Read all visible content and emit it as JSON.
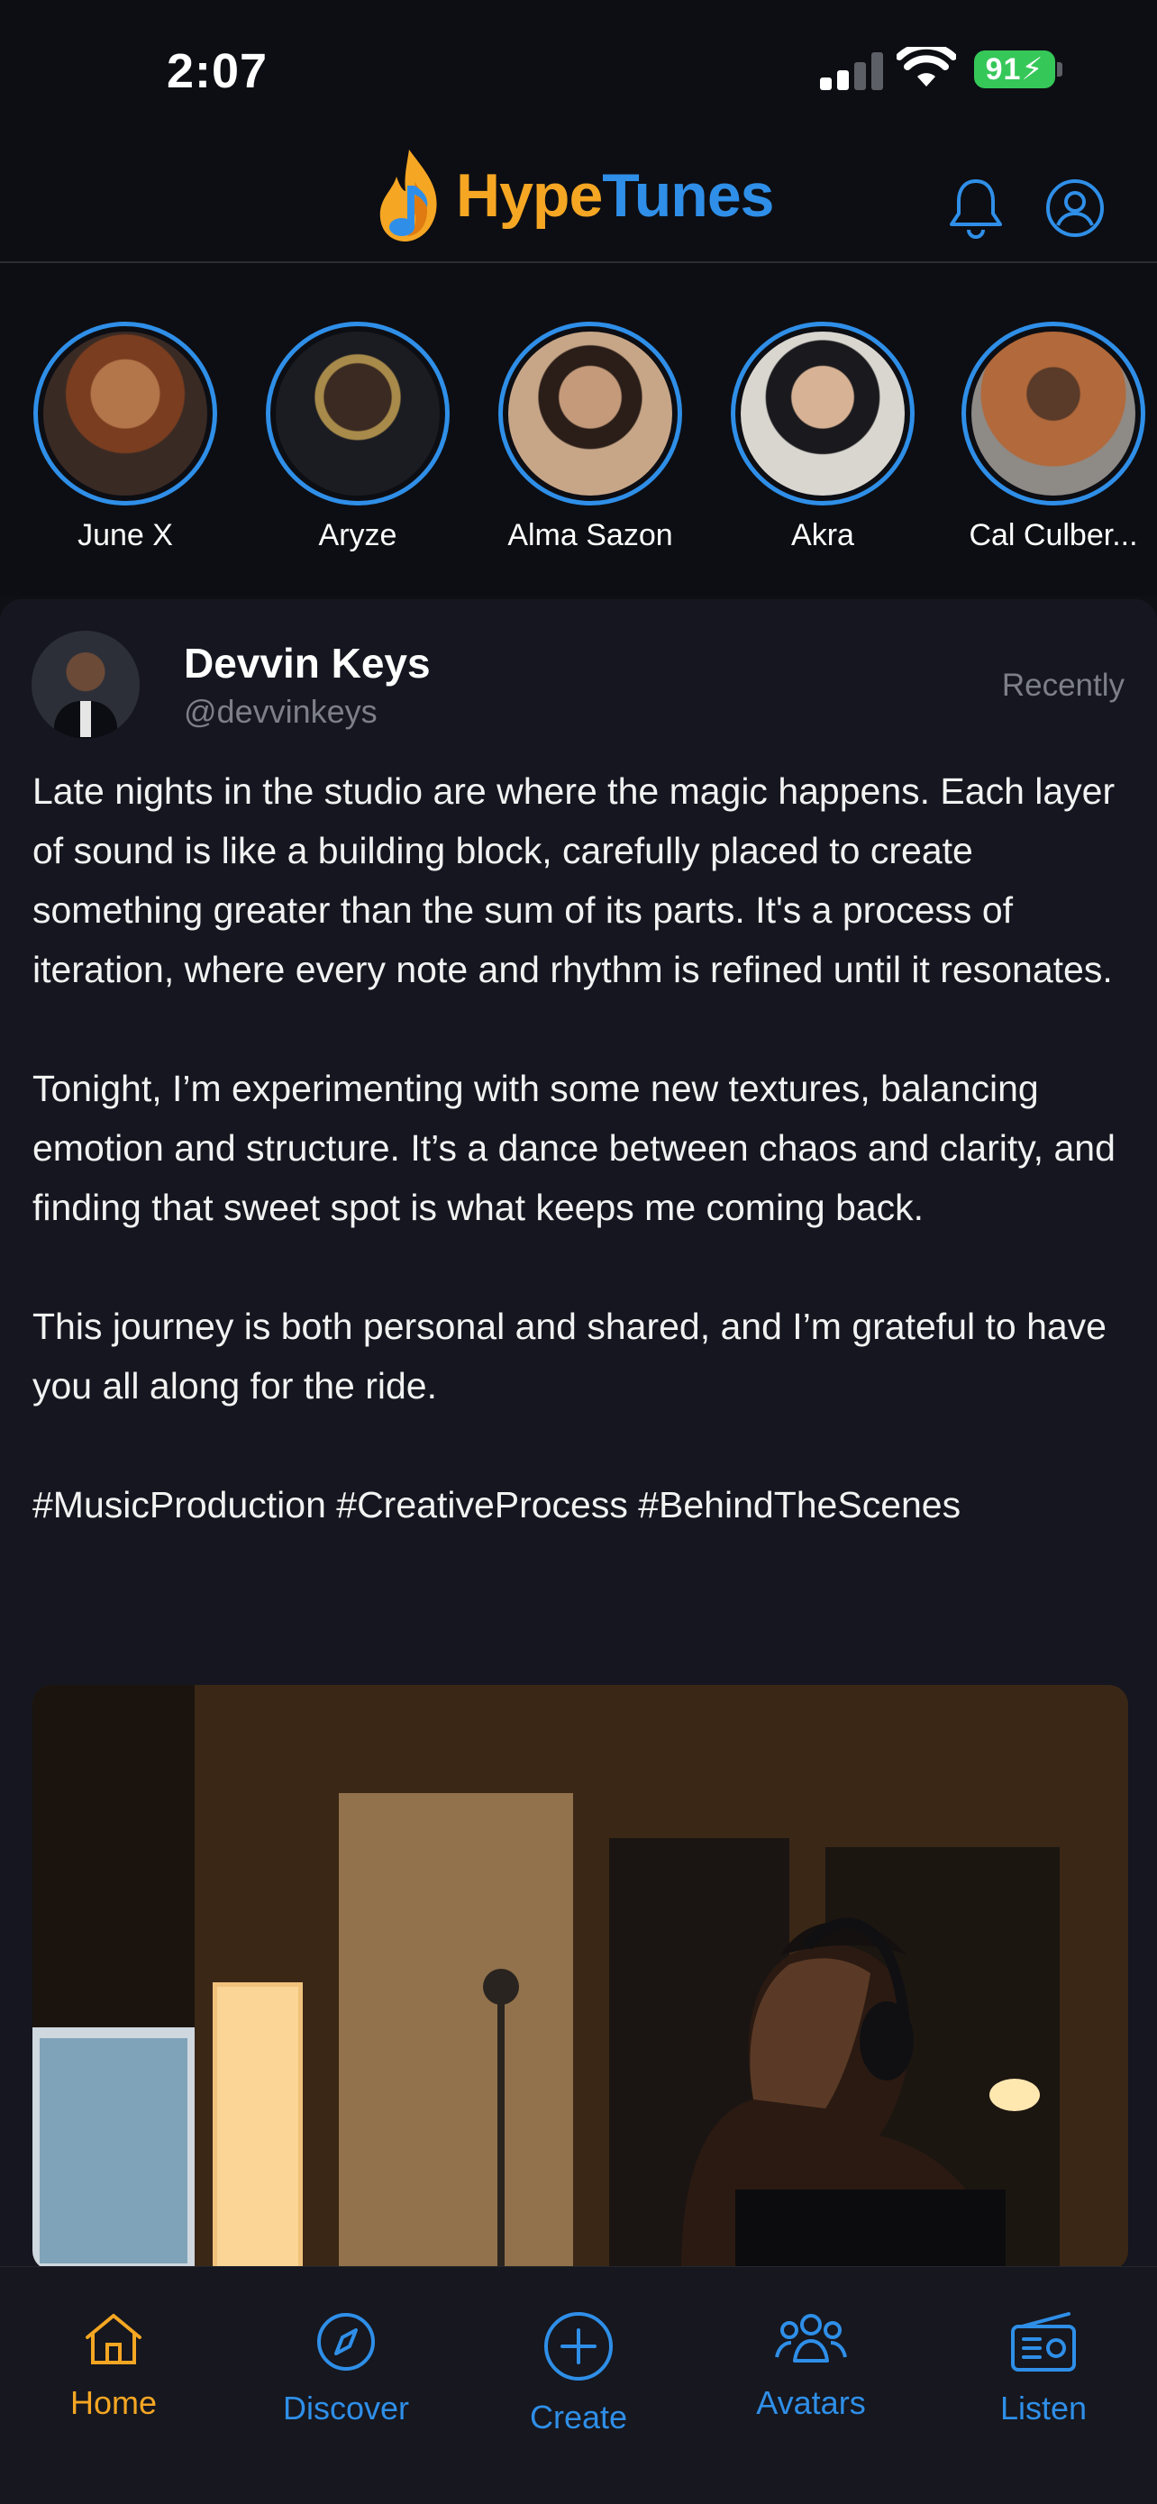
{
  "status_bar": {
    "time": "2:07",
    "battery": "91"
  },
  "header": {
    "logo_hype": "Hype",
    "logo_tunes": "Tunes"
  },
  "stories": [
    {
      "name": "June X"
    },
    {
      "name": "Aryze"
    },
    {
      "name": "Alma Sazon"
    },
    {
      "name": "Akra"
    },
    {
      "name": "Cal Culber..."
    }
  ],
  "post": {
    "author_name": "Devvin Keys",
    "author_handle": "@devvinkeys",
    "time": "Recently",
    "paragraphs": [
      "Late nights in the studio are where the magic happens. Each layer of sound is like a building block, carefully placed to create something greater than the sum of its parts. It's a process of iteration, where every note and rhythm is refined until it resonates.",
      "Tonight, I’m experimenting with some new textures, balancing emotion and structure. It’s a dance between chaos and clarity, and finding that sweet spot is what keeps me coming back.",
      "This journey is both personal and shared, and I’m grateful to have you all along for the ride.",
      "#MusicProduction #CreativeProcess #BehindTheScenes"
    ]
  },
  "nav": {
    "home": "Home",
    "discover": "Discover",
    "create": "Create",
    "avatars": "Avatars",
    "listen": "Listen"
  },
  "colors": {
    "accent_orange": "#f5a623",
    "accent_blue": "#2f8fe8",
    "background": "#0f1016"
  }
}
